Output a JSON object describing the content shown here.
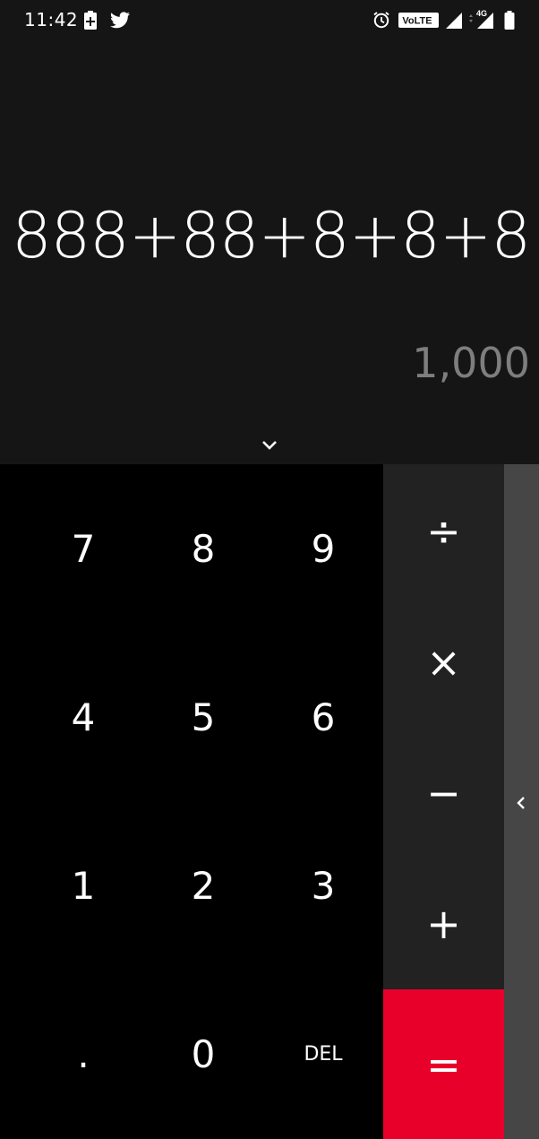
{
  "status_bar": {
    "time": "11:42",
    "left_icons": [
      "battery-saver-icon",
      "twitter-icon"
    ],
    "right_icons": [
      "alarm-icon",
      "volte-icon",
      "signal-icon",
      "4g-signal-icon",
      "battery-icon"
    ],
    "volte_label": "VoLTE",
    "network_label": "4G"
  },
  "display": {
    "expression": "888+88+8+8+8",
    "result": "1,000",
    "collapse_icon": "chevron-down-icon"
  },
  "keypad": {
    "rows": [
      [
        "7",
        "8",
        "9"
      ],
      [
        "4",
        "5",
        "6"
      ],
      [
        "1",
        "2",
        "3"
      ],
      [
        ".",
        "0",
        "DEL"
      ]
    ]
  },
  "operators": {
    "divide": "÷",
    "multiply": "×",
    "minus": "−",
    "plus": "+",
    "equals": "="
  },
  "side_panel": {
    "icon": "chevron-left-icon"
  },
  "colors": {
    "display_bg": "#151515",
    "keypad_bg": "#000000",
    "operators_bg": "#222222",
    "equals_bg": "#e8002a",
    "side_panel_bg": "#464646",
    "result_text": "#7e7e7e"
  }
}
